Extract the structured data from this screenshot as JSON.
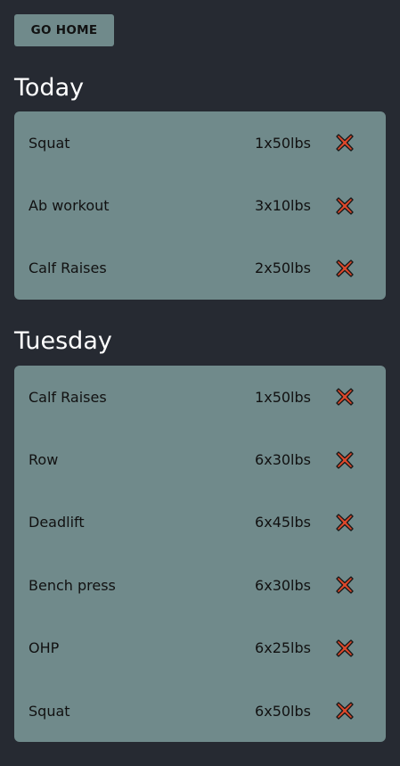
{
  "nav": {
    "home_label": "GO HOME"
  },
  "sections": [
    {
      "title": "Today",
      "items": [
        {
          "name": "Squat",
          "amount": "1x50lbs"
        },
        {
          "name": "Ab workout",
          "amount": "3x10lbs"
        },
        {
          "name": "Calf Raises",
          "amount": "2x50lbs"
        }
      ]
    },
    {
      "title": "Tuesday",
      "items": [
        {
          "name": "Calf Raises",
          "amount": "1x50lbs"
        },
        {
          "name": "Row",
          "amount": "6x30lbs"
        },
        {
          "name": "Deadlift",
          "amount": "6x45lbs"
        },
        {
          "name": "Bench press",
          "amount": "6x30lbs"
        },
        {
          "name": "OHP",
          "amount": "6x25lbs"
        },
        {
          "name": "Squat",
          "amount": "6x50lbs"
        }
      ]
    }
  ],
  "colors": {
    "background": "#262a32",
    "card": "#708a8b",
    "delete_icon_fill": "#e0482a"
  },
  "icons": {
    "delete": "cross-mark-icon"
  }
}
